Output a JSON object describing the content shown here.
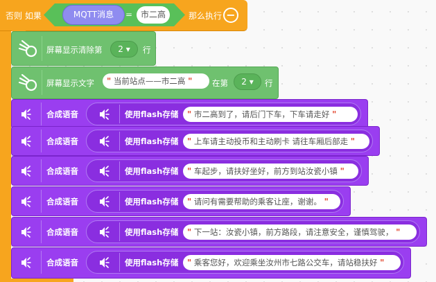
{
  "else_if_block": {
    "prefix": "否则 如果",
    "condition": {
      "variable": "MQTT消息",
      "operator": "=",
      "value": "市二高"
    },
    "then_label": "那么执行",
    "collapse_symbol": "−"
  },
  "display_blocks": [
    {
      "label": "屏幕显示清除第",
      "row_value": "2 ▾",
      "suffix": "行"
    },
    {
      "label": "屏幕显示文字",
      "text": "当前站点——市二高",
      "middle": "在第",
      "row_value": "2 ▾",
      "suffix": "行"
    }
  ],
  "speech_blocks": [
    {
      "label": "合成语音",
      "storage": "使用flash存储",
      "text": "市二高到了，请后门下车，下车请走好"
    },
    {
      "label": "合成语音",
      "storage": "使用flash存储",
      "text": "上车请主动投币和主动刷卡 请往车厢后部走"
    },
    {
      "label": "合成语音",
      "storage": "使用flash存储",
      "text": "车起步，请扶好坐好，前方到站汝瓷小镇"
    },
    {
      "label": "合成语音",
      "storage": "使用flash存储",
      "text": "请问有需要帮助的乘客让座，谢谢。"
    },
    {
      "label": "合成语音",
      "storage": "使用flash存储",
      "text": "下一站：汝瓷小镇，前方路段，请注意安全，谨慎驾驶，"
    },
    {
      "label": "合成语音",
      "storage": "使用flash存储",
      "text": "乘客您好，欢迎乘坐汝州市七路公交车，请站稳扶好"
    }
  ],
  "colors": {
    "control": "#f7a51e",
    "operator": "#59c059",
    "variable": "#8f8cf0",
    "display": "#6fc16f",
    "speech": "#9a3ef0"
  },
  "icons": {
    "display": "comet-icon",
    "speech": "speaker-icon"
  }
}
